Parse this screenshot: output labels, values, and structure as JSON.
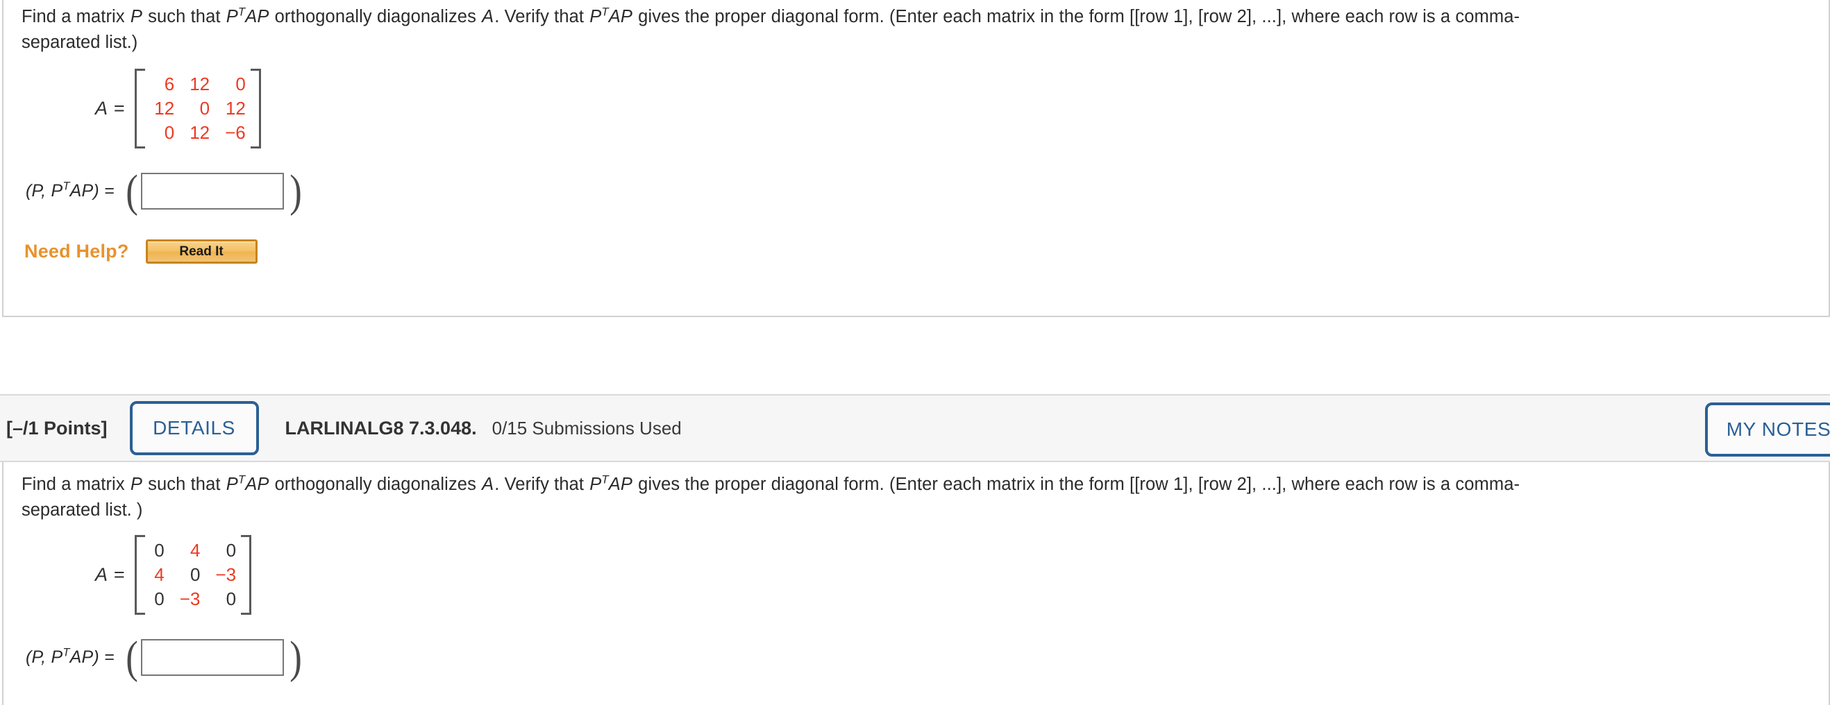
{
  "questions": [
    {
      "id": "q1",
      "prompt_line1_a": "Find a matrix ",
      "prompt_var_P": "P",
      "prompt_line1_b": " such that ",
      "prompt_expr1_base": "P",
      "prompt_expr1_sup": "T",
      "prompt_expr1_rest": "AP",
      "prompt_line1_c": " orthogonally diagonalizes ",
      "prompt_var_A": "A",
      "prompt_line1_d": ". Verify that ",
      "prompt_line1_e": " gives the proper diagonal form. (Enter each matrix in the form [[row 1], [row 2], ...], where each row is a comma-",
      "prompt_line2": "separated list.)",
      "matrix_label": "A =",
      "matrix": [
        [
          {
            "v": "6",
            "zero": false
          },
          {
            "v": "12",
            "zero": false
          },
          {
            "v": "0",
            "zero": false
          }
        ],
        [
          {
            "v": "12",
            "zero": false
          },
          {
            "v": "0",
            "zero": false
          },
          {
            "v": "12",
            "zero": false
          }
        ],
        [
          {
            "v": "0",
            "zero": false
          },
          {
            "v": "12",
            "zero": false
          },
          {
            "v": "−6",
            "zero": false
          }
        ]
      ],
      "answer_label_pre": "(P, P",
      "answer_label_sup": "T",
      "answer_label_post": "AP) =",
      "answer_value": "",
      "answer_placeholder": "",
      "paren_open": "(",
      "paren_close": ")",
      "need_help_label": "Need Help?",
      "read_it_label": "Read It"
    },
    {
      "id": "q2",
      "header": {
        "points": "[–/1 Points]",
        "details_label": "DETAILS",
        "question_code": "LARLINALG8 7.3.048.",
        "submissions": "0/15 Submissions Used",
        "my_notes_label": "MY NOTES"
      },
      "prompt_line1_a": "Find a matrix ",
      "prompt_var_P": "P",
      "prompt_line1_b": " such that ",
      "prompt_expr1_base": "P",
      "prompt_expr1_sup": "T",
      "prompt_expr1_rest": "AP",
      "prompt_line1_c": " orthogonally diagonalizes ",
      "prompt_var_A": "A",
      "prompt_line1_d": ". Verify that ",
      "prompt_line1_e": " gives the proper diagonal form. (Enter each matrix in the form [[row 1], [row 2], ...], where each row is a comma-",
      "prompt_line2": "separated list. )",
      "matrix_label": "A =",
      "matrix": [
        [
          {
            "v": "0",
            "zero": true
          },
          {
            "v": "4",
            "zero": false
          },
          {
            "v": "0",
            "zero": true
          }
        ],
        [
          {
            "v": "4",
            "zero": false
          },
          {
            "v": "0",
            "zero": true
          },
          {
            "v": "−3",
            "zero": false
          }
        ],
        [
          {
            "v": "0",
            "zero": true
          },
          {
            "v": "−3",
            "zero": false
          },
          {
            "v": "0",
            "zero": true
          }
        ]
      ],
      "answer_label_pre": "(P, P",
      "answer_label_sup": "T",
      "answer_label_post": "AP) =",
      "answer_value": "",
      "answer_placeholder": "",
      "paren_open": "(",
      "paren_close": ")"
    }
  ],
  "colors": {
    "matrix_red": "#ec3b23",
    "matrix_dark": "#333333",
    "accent_blue": "#2b6094",
    "need_help_orange": "#e8922e",
    "read_it_border": "#c8841f",
    "card_border": "#cfd1d2",
    "header_band_bg": "#f6f6f6"
  }
}
